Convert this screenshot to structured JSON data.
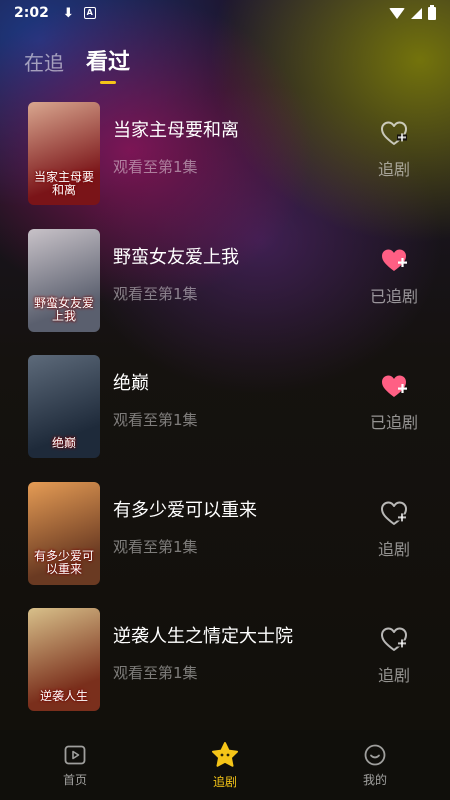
{
  "status_bar": {
    "time": "2:02"
  },
  "tabs": [
    {
      "label": "在追",
      "active": false
    },
    {
      "label": "看过",
      "active": true
    }
  ],
  "list": [
    {
      "title": "当家主母要和离",
      "progress": "观看至第1集",
      "follow_label": "追剧",
      "followed": false,
      "poster_text": "当家主母要和离",
      "poster_colors": [
        "#7a1418",
        "#d9a78f"
      ]
    },
    {
      "title": "野蛮女友爱上我",
      "progress": "观看至第1集",
      "follow_label": "已追剧",
      "followed": true,
      "poster_text": "野蛮女友爱上我",
      "poster_colors": [
        "#5a5f6e",
        "#c8c2c8"
      ]
    },
    {
      "title": "绝巅",
      "progress": "观看至第1集",
      "follow_label": "已追剧",
      "followed": true,
      "poster_text": "绝巅",
      "poster_colors": [
        "#1e2a3a",
        "#5d6a7a"
      ]
    },
    {
      "title": "有多少爱可以重来",
      "progress": "观看至第1集",
      "follow_label": "追剧",
      "followed": false,
      "poster_text": "有多少爱可以重来",
      "poster_colors": [
        "#6a3a22",
        "#e59c55"
      ]
    },
    {
      "title": "逆袭人生之情定大士院",
      "progress": "观看至第1集",
      "follow_label": "追剧",
      "followed": false,
      "poster_text": "逆袭人生",
      "poster_colors": [
        "#7a2f1c",
        "#d8c08a"
      ]
    }
  ],
  "bottom_nav": [
    {
      "label": "首页",
      "icon": "play-screen-icon",
      "active": false
    },
    {
      "label": "追剧",
      "icon": "star-icon",
      "active": true
    },
    {
      "label": "我的",
      "icon": "smiley-icon",
      "active": false
    }
  ],
  "colors": {
    "accent": "#f5c518",
    "heart_filled": "#ff5f84"
  }
}
